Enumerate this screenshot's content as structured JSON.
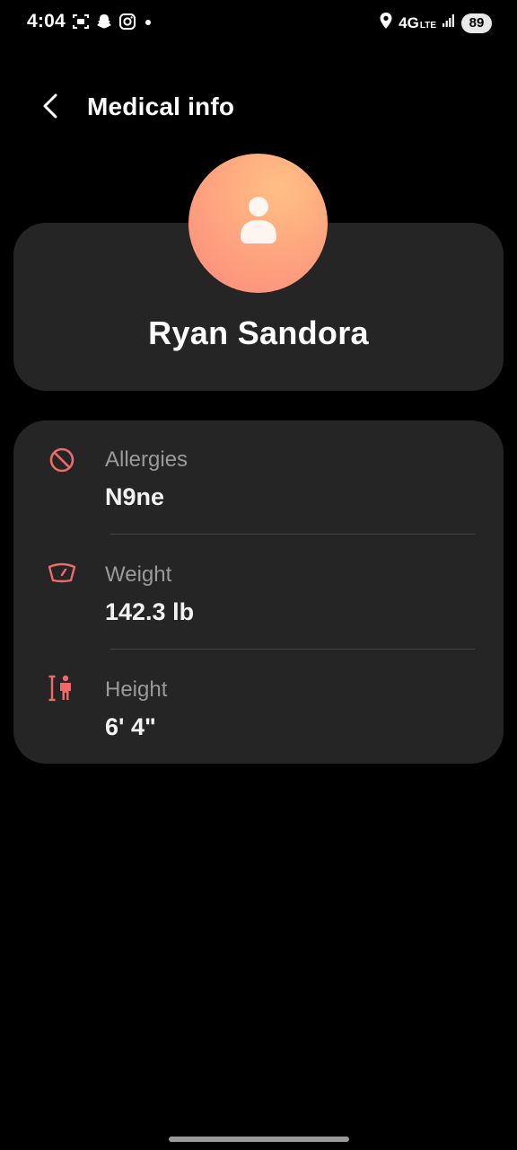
{
  "status_bar": {
    "time": "4:04",
    "network": "4G",
    "network_sub": "LTE",
    "battery": "89",
    "icons": [
      "screenshot-icon",
      "snapchat-icon",
      "instagram-icon",
      "notification-dot-icon",
      "location-icon",
      "signal-icon"
    ]
  },
  "header": {
    "title": "Medical info",
    "back_icon": "chevron-left-icon"
  },
  "profile": {
    "name": "Ryan Sandora",
    "avatar_icon": "person-icon"
  },
  "medical_info": {
    "items": [
      {
        "icon": "no-allergy-icon",
        "label": "Allergies",
        "value": "N9ne"
      },
      {
        "icon": "scale-icon",
        "label": "Weight",
        "value": "142.3 lb"
      },
      {
        "icon": "height-icon",
        "label": "Height",
        "value": "6' 4\""
      }
    ]
  },
  "colors": {
    "background": "#000000",
    "card": "#252525",
    "accent": "#ef6b6b",
    "label": "#9a9a9a",
    "avatar_gradient_start": "#ffbf85",
    "avatar_gradient_end": "#f98a7d"
  }
}
